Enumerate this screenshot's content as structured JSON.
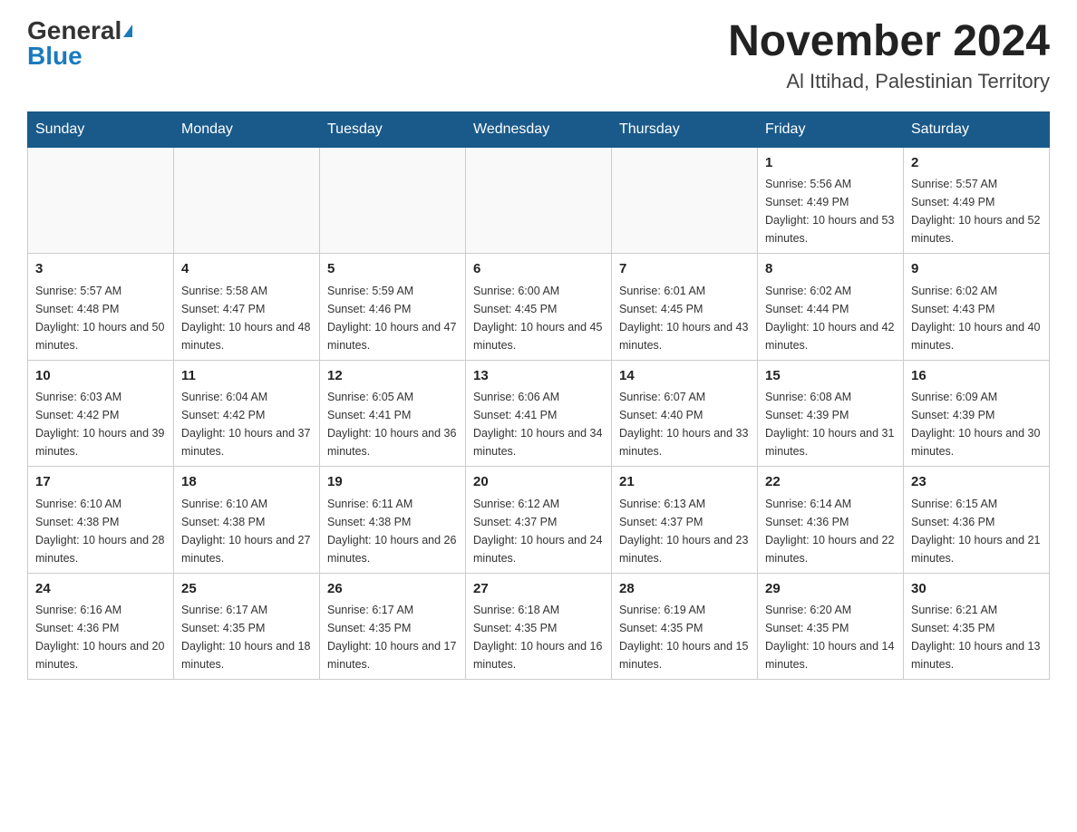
{
  "header": {
    "logo_general": "General",
    "logo_blue": "Blue",
    "month_title": "November 2024",
    "location": "Al Ittihad, Palestinian Territory"
  },
  "days_of_week": [
    "Sunday",
    "Monday",
    "Tuesday",
    "Wednesday",
    "Thursday",
    "Friday",
    "Saturday"
  ],
  "weeks": [
    [
      {
        "day": "",
        "info": ""
      },
      {
        "day": "",
        "info": ""
      },
      {
        "day": "",
        "info": ""
      },
      {
        "day": "",
        "info": ""
      },
      {
        "day": "",
        "info": ""
      },
      {
        "day": "1",
        "info": "Sunrise: 5:56 AM\nSunset: 4:49 PM\nDaylight: 10 hours and 53 minutes."
      },
      {
        "day": "2",
        "info": "Sunrise: 5:57 AM\nSunset: 4:49 PM\nDaylight: 10 hours and 52 minutes."
      }
    ],
    [
      {
        "day": "3",
        "info": "Sunrise: 5:57 AM\nSunset: 4:48 PM\nDaylight: 10 hours and 50 minutes."
      },
      {
        "day": "4",
        "info": "Sunrise: 5:58 AM\nSunset: 4:47 PM\nDaylight: 10 hours and 48 minutes."
      },
      {
        "day": "5",
        "info": "Sunrise: 5:59 AM\nSunset: 4:46 PM\nDaylight: 10 hours and 47 minutes."
      },
      {
        "day": "6",
        "info": "Sunrise: 6:00 AM\nSunset: 4:45 PM\nDaylight: 10 hours and 45 minutes."
      },
      {
        "day": "7",
        "info": "Sunrise: 6:01 AM\nSunset: 4:45 PM\nDaylight: 10 hours and 43 minutes."
      },
      {
        "day": "8",
        "info": "Sunrise: 6:02 AM\nSunset: 4:44 PM\nDaylight: 10 hours and 42 minutes."
      },
      {
        "day": "9",
        "info": "Sunrise: 6:02 AM\nSunset: 4:43 PM\nDaylight: 10 hours and 40 minutes."
      }
    ],
    [
      {
        "day": "10",
        "info": "Sunrise: 6:03 AM\nSunset: 4:42 PM\nDaylight: 10 hours and 39 minutes."
      },
      {
        "day": "11",
        "info": "Sunrise: 6:04 AM\nSunset: 4:42 PM\nDaylight: 10 hours and 37 minutes."
      },
      {
        "day": "12",
        "info": "Sunrise: 6:05 AM\nSunset: 4:41 PM\nDaylight: 10 hours and 36 minutes."
      },
      {
        "day": "13",
        "info": "Sunrise: 6:06 AM\nSunset: 4:41 PM\nDaylight: 10 hours and 34 minutes."
      },
      {
        "day": "14",
        "info": "Sunrise: 6:07 AM\nSunset: 4:40 PM\nDaylight: 10 hours and 33 minutes."
      },
      {
        "day": "15",
        "info": "Sunrise: 6:08 AM\nSunset: 4:39 PM\nDaylight: 10 hours and 31 minutes."
      },
      {
        "day": "16",
        "info": "Sunrise: 6:09 AM\nSunset: 4:39 PM\nDaylight: 10 hours and 30 minutes."
      }
    ],
    [
      {
        "day": "17",
        "info": "Sunrise: 6:10 AM\nSunset: 4:38 PM\nDaylight: 10 hours and 28 minutes."
      },
      {
        "day": "18",
        "info": "Sunrise: 6:10 AM\nSunset: 4:38 PM\nDaylight: 10 hours and 27 minutes."
      },
      {
        "day": "19",
        "info": "Sunrise: 6:11 AM\nSunset: 4:38 PM\nDaylight: 10 hours and 26 minutes."
      },
      {
        "day": "20",
        "info": "Sunrise: 6:12 AM\nSunset: 4:37 PM\nDaylight: 10 hours and 24 minutes."
      },
      {
        "day": "21",
        "info": "Sunrise: 6:13 AM\nSunset: 4:37 PM\nDaylight: 10 hours and 23 minutes."
      },
      {
        "day": "22",
        "info": "Sunrise: 6:14 AM\nSunset: 4:36 PM\nDaylight: 10 hours and 22 minutes."
      },
      {
        "day": "23",
        "info": "Sunrise: 6:15 AM\nSunset: 4:36 PM\nDaylight: 10 hours and 21 minutes."
      }
    ],
    [
      {
        "day": "24",
        "info": "Sunrise: 6:16 AM\nSunset: 4:36 PM\nDaylight: 10 hours and 20 minutes."
      },
      {
        "day": "25",
        "info": "Sunrise: 6:17 AM\nSunset: 4:35 PM\nDaylight: 10 hours and 18 minutes."
      },
      {
        "day": "26",
        "info": "Sunrise: 6:17 AM\nSunset: 4:35 PM\nDaylight: 10 hours and 17 minutes."
      },
      {
        "day": "27",
        "info": "Sunrise: 6:18 AM\nSunset: 4:35 PM\nDaylight: 10 hours and 16 minutes."
      },
      {
        "day": "28",
        "info": "Sunrise: 6:19 AM\nSunset: 4:35 PM\nDaylight: 10 hours and 15 minutes."
      },
      {
        "day": "29",
        "info": "Sunrise: 6:20 AM\nSunset: 4:35 PM\nDaylight: 10 hours and 14 minutes."
      },
      {
        "day": "30",
        "info": "Sunrise: 6:21 AM\nSunset: 4:35 PM\nDaylight: 10 hours and 13 minutes."
      }
    ]
  ]
}
